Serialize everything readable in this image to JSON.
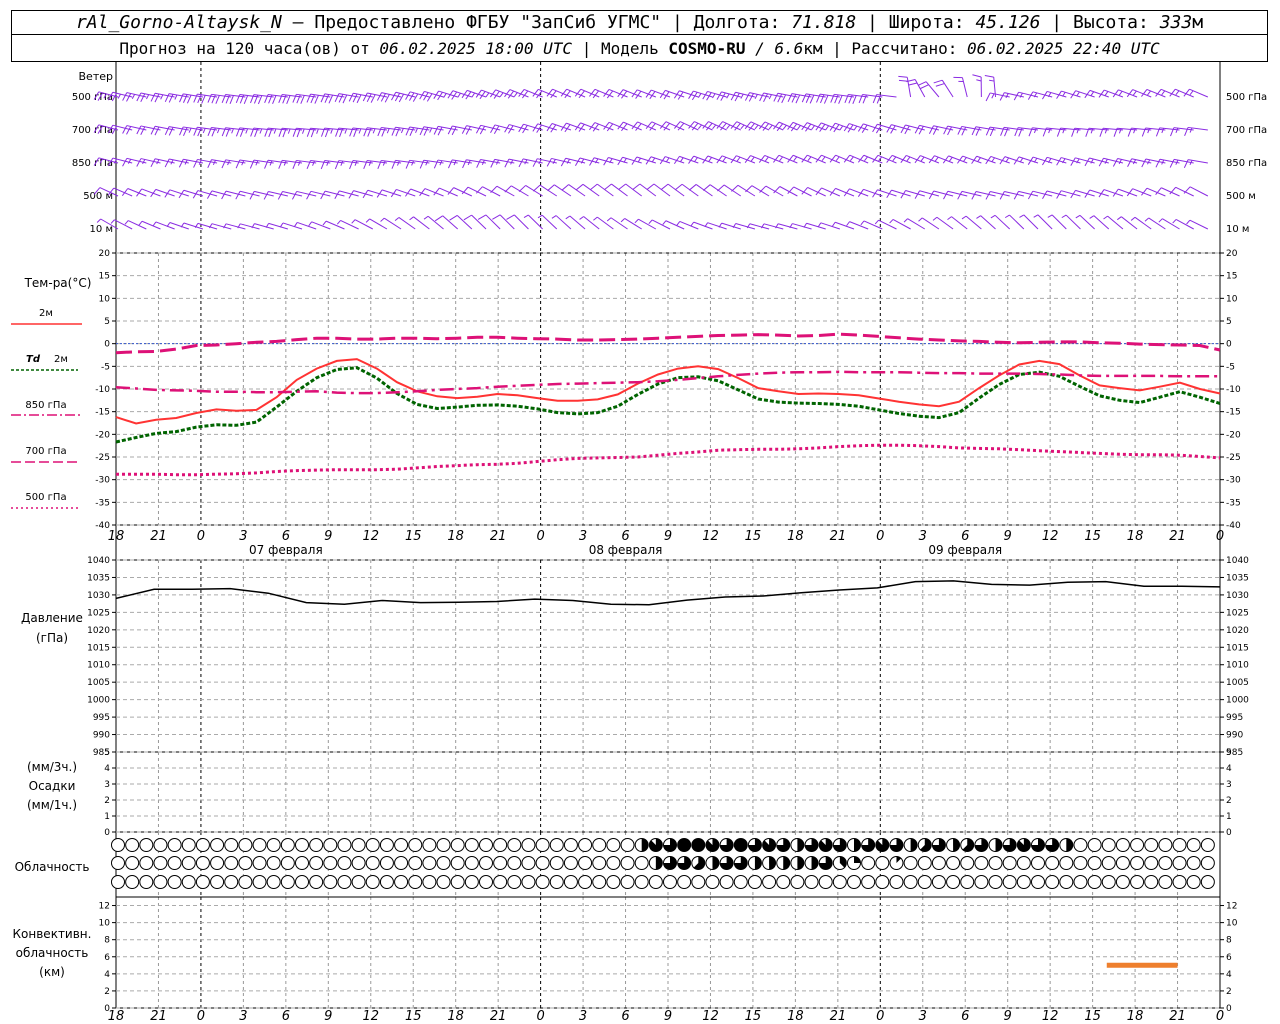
{
  "header": {
    "station": "rAl_Gorno-Altaysk_N",
    "provider": " – Предоставлено ФГБУ \"ЗапСиб УГМС\" | Долгота: ",
    "lon": "71.818",
    "lat_label": " | Широта: ",
    "lat": "45.126",
    "alt_label": " | Высота: ",
    "alt": "333",
    "alt_unit": "м",
    "line2_a": "Прогноз на 120 часа(ов) от ",
    "run": "06.02.2025 18:00 UTC",
    "line2_b": "  | Модель ",
    "model": "COSMO-RU",
    "res": " / 6.6",
    "res_unit": "км",
    "calc_label": " | Рассчитано: ",
    "calc": "06.02.2025 22:40 UTC"
  },
  "colors": {
    "wind": "#8a2be2",
    "t2m": "#ff3333",
    "td": "#006400",
    "t850": "#dd1177",
    "t700": "#dd1177",
    "t500": "#dd1177",
    "pressure": "#000000",
    "conv": "#ee7f2d",
    "zero": "#3355cc"
  },
  "chart_data": [
    {
      "type": "wind-barbs",
      "title": "Ветер",
      "levels": [
        "500 гПа",
        "700 гПа",
        "850 гПа",
        "500 м",
        "10  м"
      ],
      "x_hours": [
        0,
        6,
        12,
        18,
        24,
        30,
        36,
        42,
        48,
        54,
        60,
        66,
        72,
        78
      ],
      "speed_kn": [
        [
          25,
          30,
          30,
          30,
          25,
          20,
          20,
          25,
          30,
          20,
          15,
          15,
          15,
          20
        ],
        [
          20,
          25,
          25,
          25,
          20,
          20,
          20,
          25,
          25,
          20,
          20,
          15,
          15,
          15
        ],
        [
          15,
          15,
          15,
          15,
          15,
          15,
          15,
          15,
          15,
          15,
          15,
          15,
          15,
          15
        ],
        [
          10,
          10,
          10,
          10,
          10,
          10,
          10,
          10,
          10,
          10,
          10,
          10,
          10,
          10
        ],
        [
          5,
          5,
          5,
          5,
          10,
          5,
          5,
          5,
          5,
          5,
          5,
          5,
          5,
          5
        ]
      ]
    },
    {
      "type": "line",
      "ylabel": "Тем-ра(°C)",
      "ylim": [
        -40,
        20
      ],
      "yticks": [
        20,
        15,
        10,
        5,
        0,
        -5,
        -10,
        -15,
        -20,
        -25,
        -30,
        -35,
        -40
      ],
      "x_hours": [
        0,
        1.5,
        3,
        4.5,
        6,
        7.5,
        9,
        10.5,
        12,
        13.5,
        15,
        16.5,
        18,
        19.5,
        21,
        22.5,
        24,
        25.5,
        27,
        28.5,
        30,
        31.5,
        33,
        34.5,
        36,
        37.5,
        39,
        40.5,
        42,
        43.5,
        45,
        46.5,
        48,
        49.5,
        51,
        52.5,
        54,
        55.5,
        57,
        58.5,
        60,
        61.5,
        63,
        64.5,
        66,
        67.5,
        69,
        70.5,
        72,
        73.5,
        75,
        76.5,
        78
      ],
      "series": [
        {
          "name": "2м",
          "style": "solid",
          "values": [
            -16.2,
            -17.6,
            -16.8,
            -16.4,
            -15.3,
            -14.5,
            -14.8,
            -14.6,
            -11.8,
            -8,
            -5.5,
            -3.8,
            -3.4,
            -5.5,
            -8.5,
            -10.5,
            -11.6,
            -12.0,
            -11.7,
            -11.1,
            -11.4,
            -12.0,
            -12.6,
            -12.6,
            -12.3,
            -11.2,
            -8.8,
            -6.8,
            -5.5,
            -5.0,
            -5.6,
            -7.6,
            -9.8,
            -10.5,
            -11.1,
            -11.0,
            -11.1,
            -11.4,
            -12.1,
            -12.8,
            -13.4,
            -13.8,
            -12.8,
            -9.8,
            -7.0,
            -4.6,
            -3.8,
            -4.5,
            -7.0,
            -9.2,
            -9.8,
            -10.3,
            -9.5,
            -8.6,
            -10.0,
            -11.0
          ]
        },
        {
          "name": "Td 2м",
          "style": "dotted",
          "values": [
            -21.7,
            -20.7,
            -19.8,
            -19.4,
            -18.4,
            -17.9,
            -18.0,
            -17.3,
            -14.0,
            -10.5,
            -7.5,
            -5.7,
            -5.3,
            -7.6,
            -11.0,
            -13.4,
            -14.3,
            -14.0,
            -13.6,
            -13.5,
            -13.8,
            -14.4,
            -15.2,
            -15.5,
            -15.2,
            -13.8,
            -11.2,
            -8.9,
            -7.5,
            -7.3,
            -8.2,
            -10.2,
            -12.2,
            -12.9,
            -13.1,
            -13.2,
            -13.4,
            -13.8,
            -14.6,
            -15.4,
            -16.0,
            -16.3,
            -15.2,
            -12.0,
            -9.0,
            -6.8,
            -6.3,
            -7.2,
            -9.4,
            -11.5,
            -12.5,
            -13.0,
            -11.8,
            -10.6,
            -11.8,
            -13.2
          ]
        },
        {
          "name": "850 гПа",
          "style": "dashdot",
          "values": [
            -9.6,
            -9.9,
            -10.2,
            -10.3,
            -10.4,
            -10.6,
            -10.6,
            -10.7,
            -10.7,
            -10.6,
            -10.5,
            -10.8,
            -10.9,
            -10.9,
            -10.7,
            -10.5,
            -10.2,
            -10.0,
            -9.8,
            -9.5,
            -9.3,
            -9.1,
            -8.9,
            -8.8,
            -8.7,
            -8.6,
            -8.5,
            -8.3,
            -8.0,
            -7.6,
            -7.2,
            -6.9,
            -6.6,
            -6.4,
            -6.3,
            -6.3,
            -6.2,
            -6.3,
            -6.3,
            -6.3,
            -6.4,
            -6.5,
            -6.5,
            -6.6,
            -6.6,
            -6.6,
            -6.7,
            -6.8,
            -7.0,
            -7.1,
            -7.1,
            -7.1,
            -7.1,
            -7.2,
            -7.2,
            -7.2
          ]
        },
        {
          "name": "700 гПа",
          "style": "longdash",
          "values": [
            -2.0,
            -1.8,
            -1.7,
            -1.2,
            -0.4,
            -0.3,
            0.0,
            0.3,
            0.5,
            0.9,
            1.2,
            1.2,
            1.0,
            1.0,
            1.2,
            1.2,
            1.1,
            1.2,
            1.4,
            1.4,
            1.2,
            1.1,
            1.0,
            0.8,
            0.8,
            0.9,
            1.0,
            1.2,
            1.4,
            1.6,
            1.8,
            1.9,
            2.0,
            1.9,
            1.7,
            1.8,
            2.1,
            1.9,
            1.6,
            1.3,
            1.0,
            0.8,
            0.6,
            0.5,
            0.3,
            0.2,
            0.3,
            0.4,
            0.4,
            0.2,
            0.1,
            -0.1,
            -0.2,
            -0.3,
            -0.4,
            -1.4
          ]
        },
        {
          "name": "500 гПа",
          "style": "dotted2",
          "values": [
            -28.8,
            -28.8,
            -28.8,
            -28.9,
            -28.9,
            -28.8,
            -28.7,
            -28.5,
            -28.2,
            -28.0,
            -27.9,
            -27.8,
            -27.8,
            -27.8,
            -27.7,
            -27.4,
            -27.1,
            -26.9,
            -26.7,
            -26.6,
            -26.4,
            -26.0,
            -25.6,
            -25.3,
            -25.2,
            -25.1,
            -25.0,
            -24.6,
            -24.2,
            -23.9,
            -23.5,
            -23.4,
            -23.3,
            -23.3,
            -23.2,
            -23.0,
            -22.7,
            -22.5,
            -22.4,
            -22.4,
            -22.5,
            -22.7,
            -23.0,
            -23.1,
            -23.2,
            -23.4,
            -23.6,
            -23.8,
            -24.0,
            -24.2,
            -24.4,
            -24.5,
            -24.5,
            -24.6,
            -24.9,
            -25.2
          ]
        }
      ]
    },
    {
      "type": "line",
      "ylabel": "Давление",
      "yunit": "(гПа)",
      "ylim": [
        985,
        1040
      ],
      "yticks": [
        1040,
        1035,
        1030,
        1025,
        1020,
        1015,
        1010,
        1005,
        1000,
        995,
        990,
        985
      ],
      "x_hours": [
        0,
        3,
        6,
        9,
        12,
        15,
        18,
        21,
        24,
        27,
        30,
        33,
        36,
        39,
        42,
        45,
        48,
        51,
        54,
        57,
        60,
        63,
        66,
        69,
        72,
        75,
        78
      ],
      "series": [
        {
          "name": "pressure",
          "values": [
            1029.0,
            1031.6,
            1031.6,
            1031.8,
            1030.5,
            1027.8,
            1027.3,
            1028.4,
            1027.8,
            1027.9,
            1028.1,
            1028.8,
            1028.4,
            1027.3,
            1027.2,
            1028.5,
            1029.4,
            1029.7,
            1030.6,
            1031.4,
            1032.0,
            1033.8,
            1034.0,
            1033.0,
            1032.8,
            1033.6,
            1033.8,
            1032.5,
            1032.5,
            1032.3
          ]
        }
      ]
    },
    {
      "type": "bar",
      "ylabel": "(мм/3ч.)",
      "ylabel2": "Осадки",
      "ylabel3": "(мм/1ч.)",
      "ylim": [
        0,
        5
      ],
      "yticks": [
        5,
        4,
        3,
        2,
        1,
        0
      ],
      "values": []
    },
    {
      "type": "cloud-cover",
      "label": "Облачность",
      "rows_octa": [
        [
          0,
          0,
          0,
          0,
          0,
          0,
          0,
          0,
          0,
          0,
          0,
          0,
          0,
          0,
          0,
          0,
          0,
          0,
          0,
          0,
          0,
          0,
          0,
          0,
          0,
          0,
          0,
          0,
          0,
          0,
          0,
          0,
          0,
          0,
          0,
          0,
          0,
          4,
          7,
          6,
          8,
          8,
          7,
          6,
          8,
          6,
          7,
          6,
          4,
          6,
          7,
          6,
          4,
          6,
          7,
          6,
          4,
          5,
          6,
          4,
          5,
          6,
          4,
          6,
          7,
          6,
          6,
          4,
          0,
          0,
          0,
          0,
          0,
          0,
          0,
          0,
          0,
          0,
          0,
          0,
          0,
          0,
          0,
          0,
          0,
          0,
          0,
          0,
          0,
          0,
          0
        ],
        [
          0,
          0,
          0,
          0,
          0,
          0,
          0,
          0,
          0,
          0,
          0,
          0,
          0,
          0,
          0,
          0,
          0,
          0,
          0,
          0,
          0,
          0,
          0,
          0,
          0,
          0,
          0,
          0,
          0,
          0,
          0,
          0,
          0,
          0,
          0,
          0,
          0,
          0,
          4,
          6,
          6,
          5,
          4,
          6,
          6,
          4,
          4,
          4,
          4,
          4,
          6,
          3,
          2,
          0,
          0,
          1,
          0,
          0,
          0,
          0,
          0,
          0,
          0,
          0,
          0,
          0,
          0,
          0,
          0,
          0,
          0,
          0,
          0,
          0,
          0,
          0,
          0,
          0,
          0,
          0,
          0,
          0,
          0,
          0,
          0,
          0,
          0,
          0,
          0,
          0,
          0
        ],
        [
          0,
          0,
          0,
          0,
          0,
          0,
          0,
          0,
          0,
          0,
          0,
          0,
          0,
          0,
          0,
          0,
          0,
          0,
          0,
          0,
          0,
          0,
          0,
          0,
          0,
          0,
          0,
          0,
          0,
          0,
          0,
          0,
          0,
          0,
          0,
          0,
          0,
          0,
          0,
          0,
          0,
          0,
          0,
          0,
          0,
          0,
          0,
          0,
          0,
          0,
          0,
          0,
          0,
          0,
          0,
          0,
          0,
          0,
          0,
          0,
          0,
          0,
          0,
          0,
          0,
          0,
          0,
          0,
          0,
          0,
          0,
          0,
          0,
          0,
          0,
          0,
          0,
          0,
          0,
          0,
          0,
          0,
          0,
          0,
          0,
          0,
          0,
          0,
          0,
          0,
          0
        ]
      ]
    },
    {
      "type": "bar",
      "ylabel": "Конвективн.",
      "ylabel2": "облачность",
      "ylabel3": "(км)",
      "ylim": [
        0,
        13
      ],
      "yticks": [
        12,
        10,
        8,
        6,
        4,
        2,
        0
      ],
      "segments": [
        {
          "x0": 70,
          "x1": 75,
          "y": 5
        }
      ]
    }
  ],
  "xaxis": {
    "tick_labels": [
      "18",
      "21",
      "0",
      "3",
      "6",
      "9",
      "12",
      "15",
      "18",
      "21",
      "0",
      "3",
      "6",
      "9",
      "12",
      "15",
      "18",
      "21",
      "0",
      "3",
      "6",
      "9",
      "12",
      "15",
      "18",
      "21",
      "0"
    ],
    "dates": [
      "07 февраля",
      "08 февраля",
      "09 февраля"
    ]
  },
  "legend": {
    "t2m": "2м",
    "td_a": "Td",
    "td_b": "2м",
    "t850": "850 гПа",
    "t700": "700 гПа",
    "t500": "500 гПа"
  }
}
